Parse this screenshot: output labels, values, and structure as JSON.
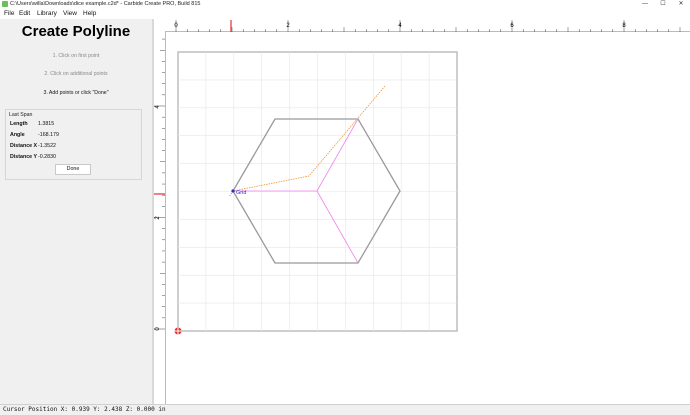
{
  "window": {
    "title": "C:\\Users\\willa\\Downloads\\dice example.c2d* - Carbide Create PRO, Build 815",
    "controls": [
      "—",
      "☐",
      "✕"
    ]
  },
  "menu": [
    "File",
    "Edit",
    "Library",
    "View",
    "Help"
  ],
  "panel": {
    "title": "Create Polyline",
    "steps": [
      "1. Click on first point",
      "2. Click on additional points",
      "3. Add points or click \"Done\""
    ],
    "last_span": {
      "legend": "Last Span",
      "rows": [
        {
          "label": "Length",
          "value": "1.3815"
        },
        {
          "label": "Angle",
          "value": "-168.179"
        },
        {
          "label": "Distance X",
          "value": "-1.3522"
        },
        {
          "label": "Distance Y",
          "value": "-0.2830"
        }
      ]
    },
    "done_label": "Done"
  },
  "rulers": {
    "top_labels": [
      "0",
      "2",
      "4",
      "6",
      "8"
    ],
    "left_labels": [
      "4",
      "2",
      "0"
    ]
  },
  "canvas": {
    "snap_label": "Grid",
    "colors": {
      "hexagon": "#999999",
      "pink_lines": "#ee82ee",
      "orange_line": "#e8973a",
      "snap": "#2a2acc",
      "marker": "#e03030"
    }
  },
  "status": {
    "text": "Cursor Position X: 0.939 Y: 2.438 Z: 0.000 in"
  }
}
